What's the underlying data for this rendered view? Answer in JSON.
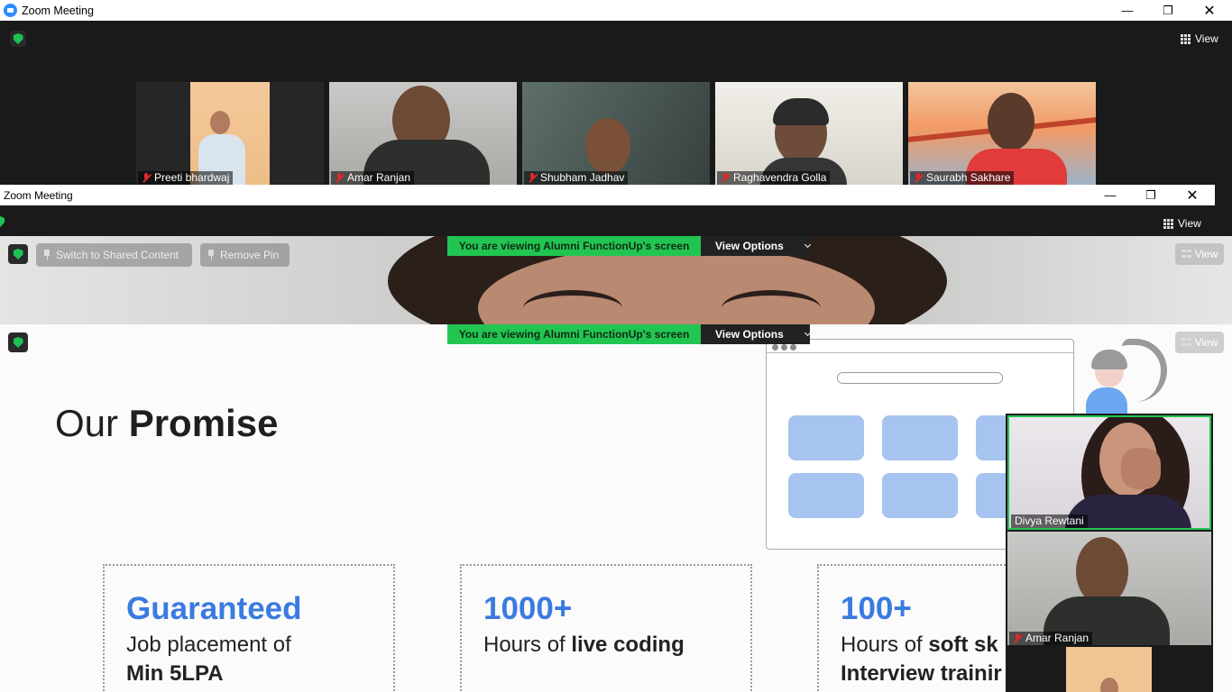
{
  "back_window": {
    "title": "Zoom Meeting",
    "view_label": "View",
    "participants": [
      {
        "name": "Preeti bhardwaj"
      },
      {
        "name": "Amar Ranjan"
      },
      {
        "name": "Shubham Jadhav"
      },
      {
        "name": "Raghavendra Golla"
      },
      {
        "name": "Saurabh Sakhare"
      }
    ]
  },
  "front_window": {
    "title": "Zoom Meeting",
    "view_label": "View",
    "switch_label": "Switch to Shared Content",
    "remove_pin_label": "Remove Pin",
    "share_text": "You are viewing Alumni FunctionUp's screen",
    "view_options_label": "View Options",
    "slide_view_label": "View"
  },
  "slide": {
    "title_light": "Our ",
    "title_bold": "Promise",
    "cards": [
      {
        "big": "Guaranteed",
        "line1": "Job placement of",
        "line2_bold": "Min 5LPA"
      },
      {
        "big": "1000+",
        "line1_plain": "Hours of ",
        "line1_bold": "live coding"
      },
      {
        "big": "100+",
        "line1_plain": "Hours of ",
        "line1_bold": "soft sk",
        "line2_bold": "Interview trainir"
      }
    ]
  },
  "side_videos": [
    {
      "name": "Divya Rewtani"
    },
    {
      "name": "Amar Ranjan"
    }
  ],
  "colors": {
    "zoom_blue": "#2d8cff",
    "share_green": "#23c552",
    "slide_accent": "#3a7be0",
    "mute_red": "#e02828"
  }
}
